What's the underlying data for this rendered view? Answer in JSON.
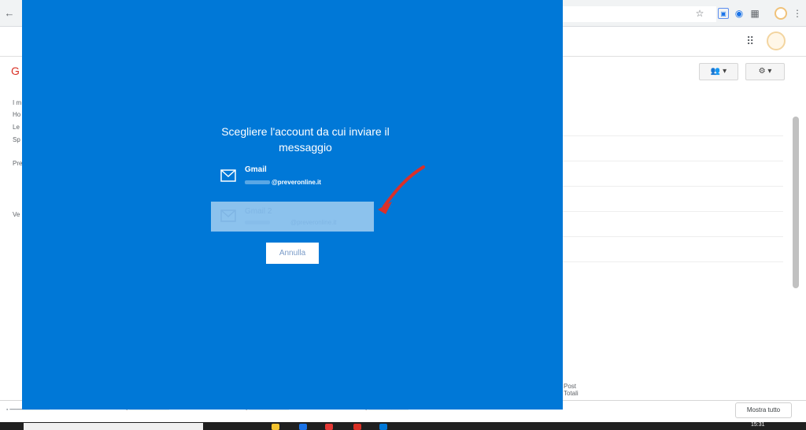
{
  "dialog": {
    "title": "Scegliere l'account da cui inviare il messaggio",
    "accounts": [
      {
        "name": "Gmail",
        "email": "@preveronline.it",
        "icon": "mail-icon"
      },
      {
        "name": "Gmail 2",
        "email": "@preveronline.it",
        "icon": "mail-icon"
      }
    ],
    "cancel_label": "Annulla"
  },
  "background": {
    "left_letter": "G",
    "sidebar_links": [
      "I m",
      "Ho",
      "Le",
      "Sp",
      "Pre",
      "Ve"
    ],
    "post_text": [
      "Post",
      "Totali"
    ]
  },
  "download_bar": {
    "show_all_label": "Mostra tutto"
  },
  "taskbar": {
    "clock": "15:31"
  },
  "colors": {
    "dialog_blue": "#0078d7",
    "arrow_red": "#d9302a"
  }
}
